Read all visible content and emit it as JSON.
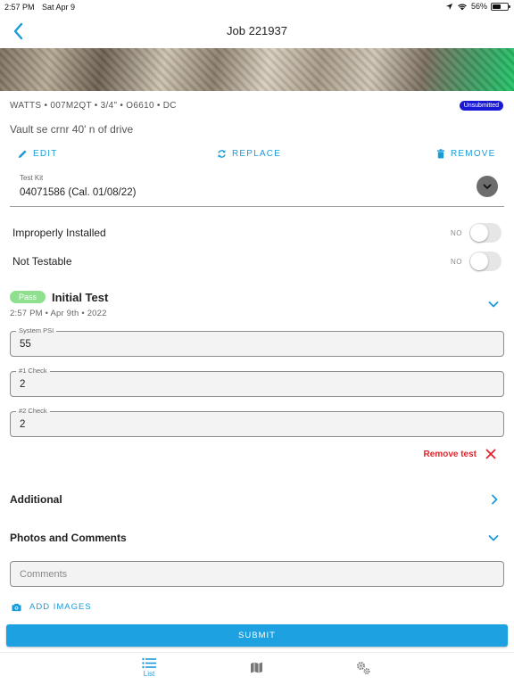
{
  "status_bar": {
    "time": "2:57 PM",
    "date": "Sat Apr 9",
    "battery": "56%",
    "battery_level": 0.56
  },
  "header": {
    "title": "Job 221937"
  },
  "device": {
    "specs": "WATTS • 007M2QT • 3/4\" • O6610 • DC",
    "status_badge": "Unsubmitted",
    "location": "Vault se crnr 40' n of drive"
  },
  "actions": {
    "edit": "EDIT",
    "replace": "REPLACE",
    "remove": "REMOVE"
  },
  "test_kit": {
    "label": "Test Kit",
    "value": "04071586 (Cal. 01/08/22)"
  },
  "toggles": [
    {
      "label": "Improperly Installed",
      "state": "NO",
      "on": false
    },
    {
      "label": "Not Testable",
      "state": "NO",
      "on": false
    }
  ],
  "test": {
    "result": "Pass",
    "title": "Initial Test",
    "timestamp": "2:57 PM • Apr 9th • 2022",
    "fields": [
      {
        "label": "System PSI",
        "value": "55"
      },
      {
        "label": "#1 Check",
        "value": "2"
      },
      {
        "label": "#2 Check",
        "value": "2"
      }
    ],
    "remove_label": "Remove test"
  },
  "sections": {
    "additional": "Additional",
    "photos_comments": "Photos and Comments"
  },
  "comments": {
    "placeholder": "Comments",
    "value": ""
  },
  "add_images": "ADD IMAGES",
  "submit": "SUBMIT",
  "tab_bar": {
    "list_label": "List",
    "map_icon": "map-icon",
    "settings_icon": "gear-icon"
  },
  "colors": {
    "accent": "#1a9bd7",
    "badge": "#1a1ad6",
    "pass": "#8fe08e",
    "danger": "#e0242c",
    "submit": "#1da1e0"
  }
}
